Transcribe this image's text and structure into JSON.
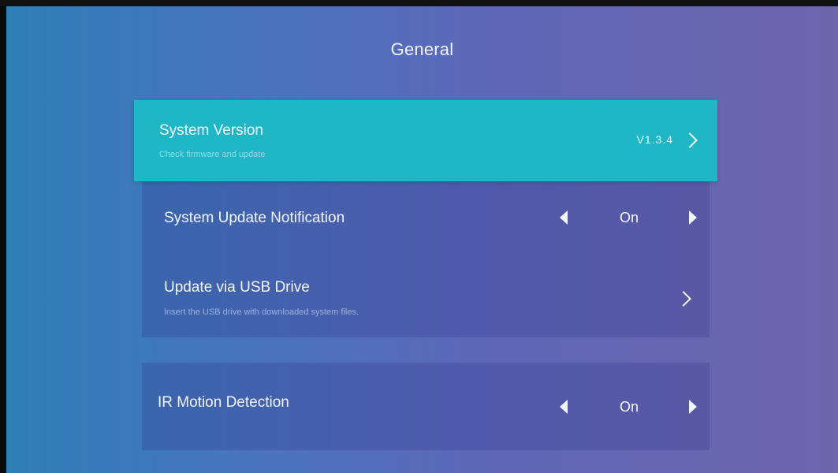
{
  "screen": {
    "title": "General"
  },
  "items": {
    "system_version": {
      "label": "System Version",
      "description": "Check firmware and update",
      "value": "V1.3.4"
    },
    "system_update_notification": {
      "label": "System Update Notification",
      "value": "On"
    },
    "update_via_usb": {
      "label": "Update via USB Drive",
      "description": "Insert the USB drive with downloaded system files."
    },
    "ir_motion_detection": {
      "label": "IR Motion Detection",
      "value": "On"
    }
  },
  "icons": {
    "chevron": "chevron-right-icon",
    "arrow_left": "triangle-left-icon",
    "arrow_right": "triangle-right-icon"
  },
  "colors": {
    "focus_highlight": "#1fb7c6",
    "background_left": "#2f7fb6",
    "background_right": "#6f66ad"
  }
}
